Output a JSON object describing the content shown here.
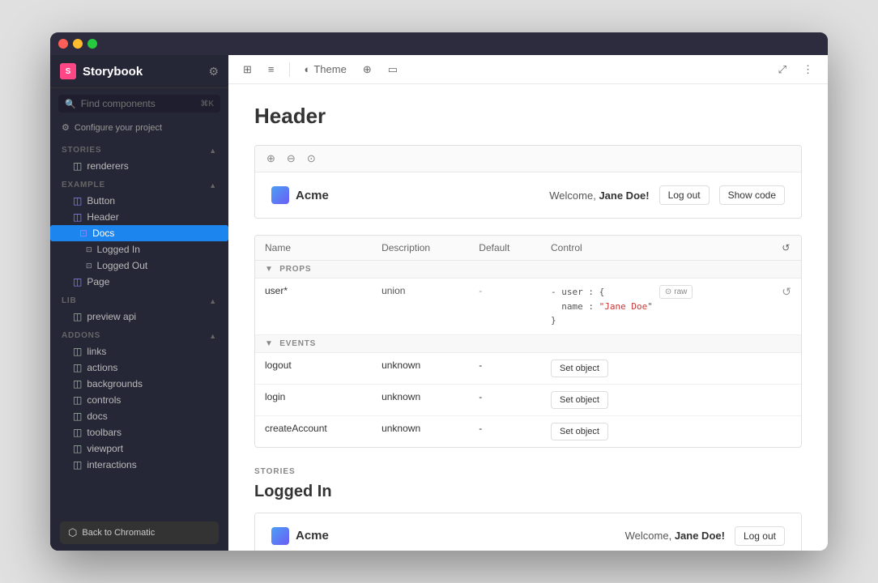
{
  "window": {
    "title": "Storybook"
  },
  "sidebar": {
    "title": "Storybook",
    "logo": "S",
    "search_placeholder": "Find components",
    "configure_label": "Configure your project",
    "sections": [
      {
        "id": "stories",
        "label": "STORIES",
        "items": [
          {
            "id": "renderers",
            "label": "renderers",
            "level": 1,
            "type": "folder"
          }
        ]
      },
      {
        "id": "example",
        "label": "EXAMPLE",
        "items": [
          {
            "id": "button",
            "label": "Button",
            "level": 1,
            "type": "component"
          },
          {
            "id": "header",
            "label": "Header",
            "level": 1,
            "type": "component"
          },
          {
            "id": "docs",
            "label": "Docs",
            "level": 2,
            "type": "docs",
            "active": true
          },
          {
            "id": "logged-in",
            "label": "Logged In",
            "level": 3,
            "type": "story"
          },
          {
            "id": "logged-out",
            "label": "Logged Out",
            "level": 3,
            "type": "story"
          },
          {
            "id": "page",
            "label": "Page",
            "level": 1,
            "type": "component"
          }
        ]
      },
      {
        "id": "lib",
        "label": "LIB",
        "items": [
          {
            "id": "preview-api",
            "label": "preview api",
            "level": 1,
            "type": "folder"
          }
        ]
      },
      {
        "id": "addons",
        "label": "ADDONS",
        "items": [
          {
            "id": "links",
            "label": "links",
            "level": 1,
            "type": "folder"
          },
          {
            "id": "actions",
            "label": "actions",
            "level": 1,
            "type": "folder"
          },
          {
            "id": "backgrounds",
            "label": "backgrounds",
            "level": 1,
            "type": "folder"
          },
          {
            "id": "controls",
            "label": "controls",
            "level": 1,
            "type": "folder"
          },
          {
            "id": "docs",
            "label": "docs",
            "level": 1,
            "type": "folder"
          },
          {
            "id": "toolbars",
            "label": "toolbars",
            "level": 1,
            "type": "folder"
          },
          {
            "id": "viewport",
            "label": "viewport",
            "level": 1,
            "type": "folder"
          },
          {
            "id": "interactions",
            "label": "interactions",
            "level": 1,
            "type": "folder"
          }
        ]
      }
    ],
    "back_button": "Back to Chromatic"
  },
  "toolbar": {
    "theme_label": "Theme",
    "icon_grid": "⊞",
    "icon_list": "≡",
    "icon_moon": "◐",
    "icon_globe": "⊕",
    "icon_tablet": "▭",
    "icon_expand": "⤢"
  },
  "content": {
    "page_title": "Header",
    "preview": {
      "acme_name": "Acme",
      "welcome_text": "Welcome,",
      "user_name": "Jane Doe!",
      "logout_label": "Log out",
      "show_code_label": "Show code"
    },
    "table": {
      "columns": [
        "Name",
        "Description",
        "Default",
        "Control"
      ],
      "sections": [
        {
          "id": "props",
          "label": "PROPS",
          "rows": [
            {
              "name": "user*",
              "description": "union",
              "default": "",
              "control_type": "code",
              "control_value": "user : {\n  name : \"Jane Doe\"\n}"
            }
          ]
        },
        {
          "id": "events",
          "label": "EVENTS",
          "rows": [
            {
              "name": "logout",
              "description": "unknown",
              "default": "-",
              "control_type": "button",
              "control_label": "Set object"
            },
            {
              "name": "login",
              "description": "unknown",
              "default": "-",
              "control_type": "button",
              "control_label": "Set object"
            },
            {
              "name": "createAccount",
              "description": "unknown",
              "default": "-",
              "control_type": "button",
              "control_label": "Set object"
            }
          ]
        }
      ]
    },
    "stories": {
      "section_label": "STORIES",
      "story_title": "Logged In",
      "acme_name": "Acme",
      "welcome_text": "Welcome,",
      "user_name": "Jane Doe!",
      "logout_label": "Log out"
    }
  }
}
